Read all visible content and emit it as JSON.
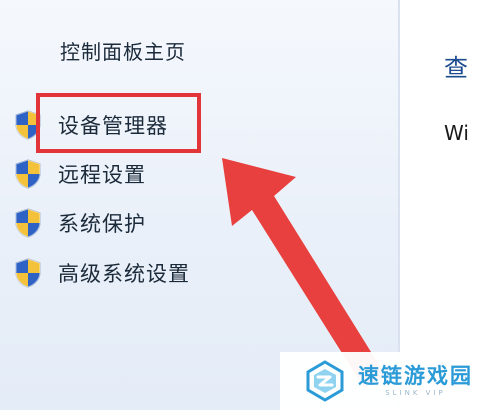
{
  "sidebar": {
    "home_link": "控制面板主页",
    "tasks": [
      {
        "label": "设备管理器",
        "icon": "uac-shield-icon"
      },
      {
        "label": "远程设置",
        "icon": "uac-shield-icon"
      },
      {
        "label": "系统保护",
        "icon": "uac-shield-icon"
      },
      {
        "label": "高级系统设置",
        "icon": "uac-shield-icon"
      }
    ]
  },
  "main": {
    "title": "查",
    "text": "Wi"
  },
  "annotation": {
    "highlight_color": "#e2353a",
    "arrow_color": "#e8403e"
  },
  "watermark": {
    "title": "速链游戏园",
    "subtitle": "SLINK VIP",
    "color": "#2b9bd8"
  }
}
